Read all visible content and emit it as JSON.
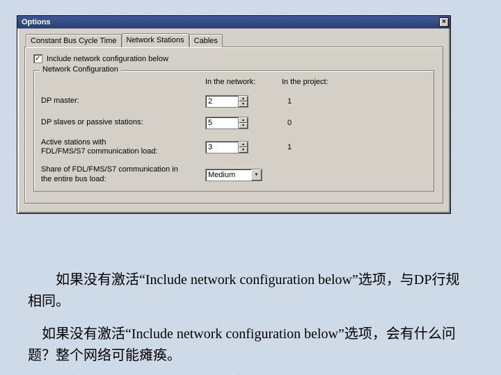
{
  "window": {
    "title": "Options",
    "close_glyph": "×"
  },
  "tabs": [
    {
      "label": "Constant Bus Cycle Time"
    },
    {
      "label": "Network Stations"
    },
    {
      "label": "Cables"
    }
  ],
  "checkbox": {
    "checked_glyph": "✓",
    "label": "Include network configuration below"
  },
  "group": {
    "legend": "Network Configuration",
    "header_network": "In the network:",
    "header_project": "In the project:",
    "rows": [
      {
        "label": "DP master:",
        "network_value": "2",
        "project_value": "1",
        "type": "spin"
      },
      {
        "label": "DP slaves or passive stations:",
        "network_value": "5",
        "project_value": "0",
        "type": "spin"
      },
      {
        "label": "Active stations with\nFDL/FMS/S7 communication load:",
        "network_value": "3",
        "project_value": "1",
        "type": "spin"
      },
      {
        "label": "Share of FDL/FMS/S7 communication in\nthe entire bus load:",
        "network_value": "Medium",
        "project_value": "",
        "type": "combo"
      }
    ]
  },
  "captions": {
    "p1": "　　如果没有激活“Include network configuration below”选项，与DP行规相同。",
    "p2": "　如果没有激活“Include network configuration below”选项，会有什么问题？整个网络可能瘫痪。"
  }
}
